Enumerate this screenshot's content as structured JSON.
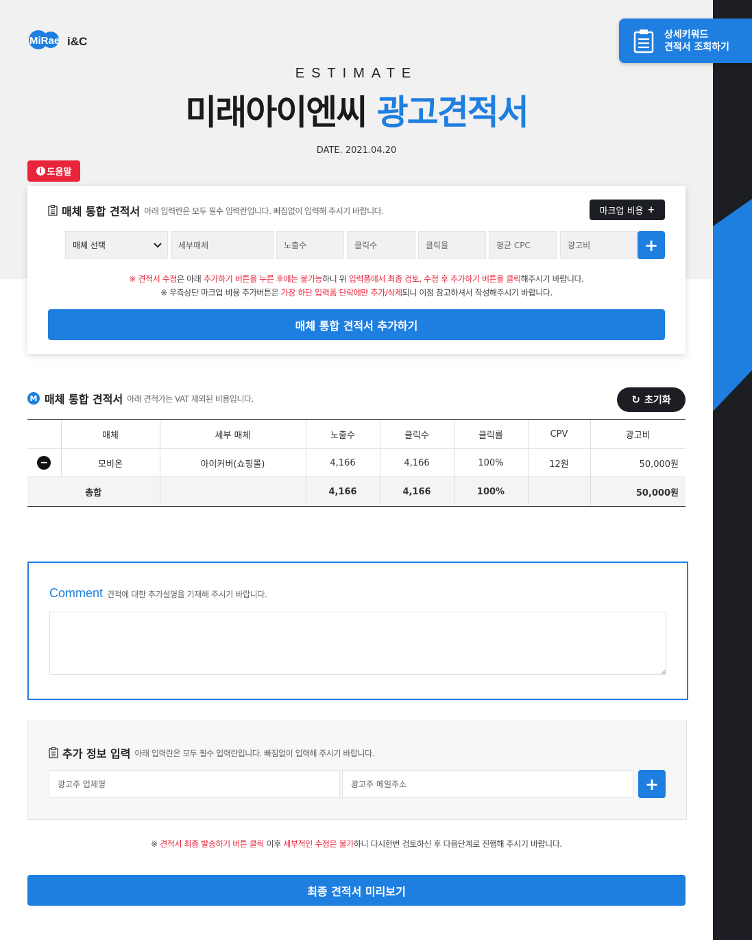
{
  "brand": {
    "logo_text_1": "MiRae",
    "logo_text_2": "i&C",
    "accent": "#1e7fe0",
    "danger": "#e8253a",
    "dark": "#1c1e24"
  },
  "quick": {
    "line1": "상세키워드",
    "line2": "견적서 조회하기",
    "icon": "clipboard-icon"
  },
  "header": {
    "estimate": "ESTIMATE",
    "title_main": "미래아이엔씨",
    "title_accent": "광고견적서",
    "date": "DATE. 2021.04.20"
  },
  "help": {
    "icon": "info-icon",
    "label": "도움말"
  },
  "media_form": {
    "title": "매체 통합 견적서",
    "desc": "아래 입력란은 모두 필수 입력란입니다. 빠짐없이 입력해 주시기 바랍니다.",
    "markup_label": "마크업 비용",
    "markup_plus": "+",
    "select_value": "매체 선택",
    "placeholders": {
      "detail": "세부매체",
      "impressions": "노출수",
      "clicks": "클릭수",
      "ctr": "클릭율",
      "cpc": "평균 CPC",
      "cost": "광고비"
    },
    "add_label": "+",
    "note1": {
      "p1": "※ 견적서 수정",
      "p2": "은 아래 ",
      "p3": "추가하기 버튼을 누른 후에는 불가능",
      "p4": "하니 위 ",
      "p5": "입력폼에서 최종 검토, 수정 후 추가하기 버튼을 클릭",
      "p6": "해주시기 바랍니다."
    },
    "note2": {
      "p1": "※ 우측상단 마크업 비용 추가버튼은 ",
      "p2": "가장 하단 입력폼 단락에만 추가/삭제",
      "p3": "되니 이점 참고하셔서 작성해주시기 바랍니다."
    },
    "submit_label": "매체 통합 견적서 추가하기"
  },
  "estimate_table": {
    "badge": "M",
    "title": "매체 통합 견적서",
    "desc": "아래 견적가는 VAT 제외된 비용입니다.",
    "reset_icon": "↻",
    "reset_label": "초기화",
    "columns": [
      "",
      "매체",
      "세부 매체",
      "노출수",
      "클릭수",
      "클릭률",
      "CPV",
      "광고비"
    ],
    "rows": [
      {
        "remove": "−",
        "media": "모비온",
        "detail": "아이커버(쇼핑몰)",
        "impressions": "4,166",
        "clicks": "4,166",
        "ctr": "100%",
        "cpv": "12원",
        "cost": "50,000원"
      }
    ],
    "total": {
      "label": "총합",
      "detail": "",
      "impressions": "4,166",
      "clicks": "4,166",
      "ctr": "100%",
      "cpv": "",
      "cost": "50,000원"
    }
  },
  "comment": {
    "title": "Comment",
    "desc": "견적에 대한 추가설명을 기재해 주시기 바랍니다.",
    "value": ""
  },
  "extra_info": {
    "title": "추가 정보 입력",
    "desc": "아래 입력란은 모두 필수 입력란입니다. 빠짐없이 입력해 주시기 바랍니다.",
    "company_placeholder": "광고주 업체명",
    "email_placeholder": "광고주 메일주소",
    "add_label": "+"
  },
  "final_note": {
    "p1": "※ ",
    "p2": "견적서 최종 발송하기 버튼 클릭",
    "p3": " 이후 ",
    "p4": "세부적인 수정은 불가",
    "p5": "하니 다시한번 검토하신 후 다음단계로 진행해 주시기 바랍니다."
  },
  "preview_label": "최종 견적서 미리보기"
}
